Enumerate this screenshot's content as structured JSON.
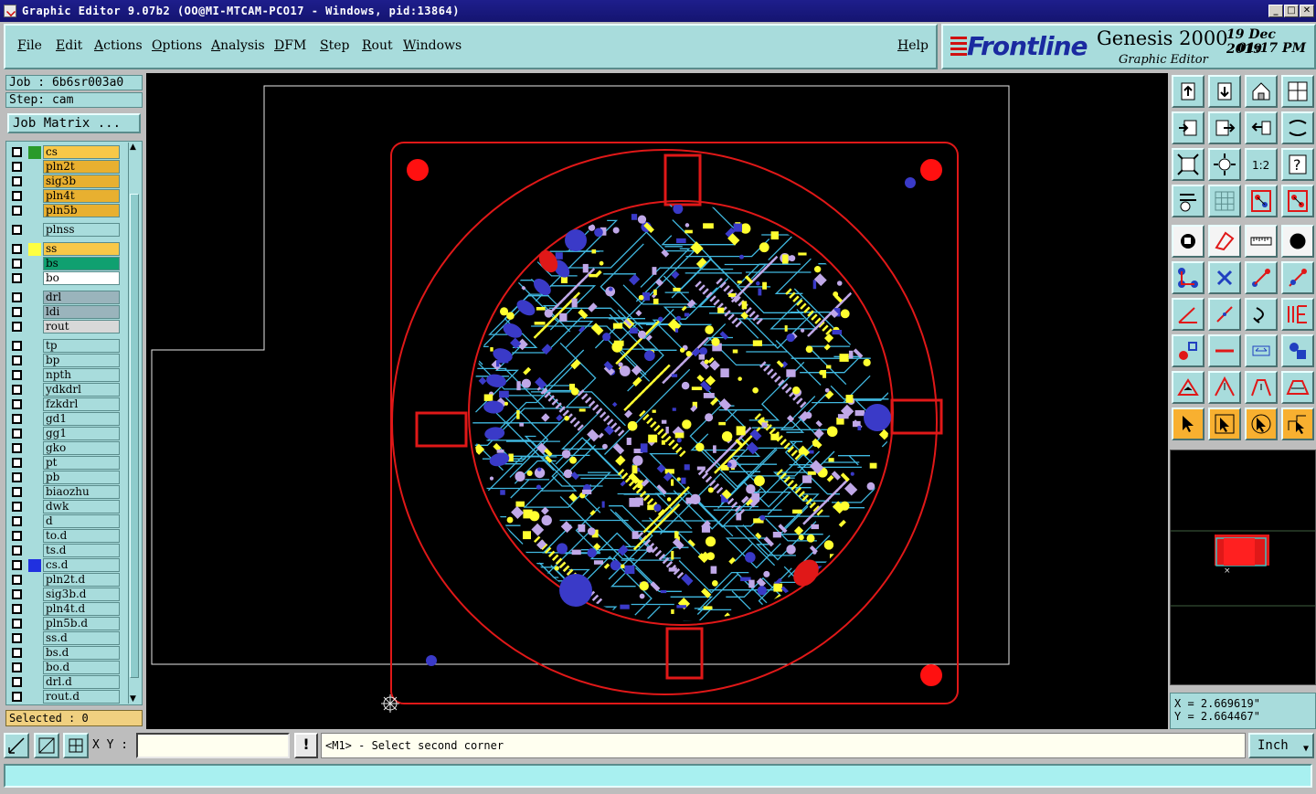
{
  "window": {
    "title": "Graphic Editor 9.07b2 (OO@MI-MTCAM-PCO17 - Windows, pid:13864)",
    "minimize": "_",
    "maximize": "□",
    "close": "✕"
  },
  "menu": {
    "items": [
      "File",
      "Edit",
      "Actions",
      "Options",
      "Analysis",
      "DFM",
      "Step",
      "Rout",
      "Windows"
    ],
    "help": "Help"
  },
  "logo": {
    "brand": "Frontline",
    "product": "Genesis 2000",
    "subtitle": "Graphic Editor",
    "date": "19 Dec 2019",
    "time": "01:17 PM"
  },
  "job": {
    "job_label": "Job : 6b6sr003a0",
    "step_label": "Step: cam",
    "job_matrix_button": "Job Matrix ..."
  },
  "layers": [
    {
      "name": "cs",
      "color": "#f8c848",
      "swatch": "#2a9a2a"
    },
    {
      "name": "pln2t",
      "color": "#e8b030",
      "swatch": ""
    },
    {
      "name": "sig3b",
      "color": "#e8b030",
      "swatch": ""
    },
    {
      "name": "pln4t",
      "color": "#e8b030",
      "swatch": ""
    },
    {
      "name": "pln5b",
      "color": "#e8b030",
      "swatch": ""
    },
    {
      "name": "plnss",
      "color": "#a8dcdc",
      "swatch": ""
    },
    {
      "name": "ss",
      "color": "#f8c848",
      "swatch": "#ffff40"
    },
    {
      "name": "bs",
      "color": "#10a070",
      "swatch": ""
    },
    {
      "name": "bo",
      "color": "#ffffff",
      "swatch": ""
    },
    {
      "name": "drl",
      "color": "#9ab4bc",
      "swatch": ""
    },
    {
      "name": "ldi",
      "color": "#9ab4bc",
      "swatch": ""
    },
    {
      "name": "rout",
      "color": "#d8d8d8",
      "swatch": ""
    },
    {
      "name": "tp",
      "color": "#a8dcdc",
      "swatch": ""
    },
    {
      "name": "bp",
      "color": "#a8dcdc",
      "swatch": ""
    },
    {
      "name": "npth",
      "color": "#a8dcdc",
      "swatch": ""
    },
    {
      "name": "ydkdrl",
      "color": "#a8dcdc",
      "swatch": ""
    },
    {
      "name": "fzkdrl",
      "color": "#a8dcdc",
      "swatch": ""
    },
    {
      "name": "gd1",
      "color": "#a8dcdc",
      "swatch": ""
    },
    {
      "name": "gg1",
      "color": "#a8dcdc",
      "swatch": ""
    },
    {
      "name": "gko",
      "color": "#a8dcdc",
      "swatch": ""
    },
    {
      "name": "pt",
      "color": "#a8dcdc",
      "swatch": ""
    },
    {
      "name": "pb",
      "color": "#a8dcdc",
      "swatch": ""
    },
    {
      "name": "biaozhu",
      "color": "#a8dcdc",
      "swatch": ""
    },
    {
      "name": "dwk",
      "color": "#a8dcdc",
      "swatch": ""
    },
    {
      "name": "d",
      "color": "#a8dcdc",
      "swatch": ""
    },
    {
      "name": "to.d",
      "color": "#a8dcdc",
      "swatch": ""
    },
    {
      "name": "ts.d",
      "color": "#a8dcdc",
      "swatch": ""
    },
    {
      "name": "cs.d",
      "color": "#a8dcdc",
      "swatch": "#2030e0"
    },
    {
      "name": "pln2t.d",
      "color": "#a8dcdc",
      "swatch": ""
    },
    {
      "name": "sig3b.d",
      "color": "#a8dcdc",
      "swatch": ""
    },
    {
      "name": "pln4t.d",
      "color": "#a8dcdc",
      "swatch": ""
    },
    {
      "name": "pln5b.d",
      "color": "#a8dcdc",
      "swatch": ""
    },
    {
      "name": "ss.d",
      "color": "#a8dcdc",
      "swatch": ""
    },
    {
      "name": "bs.d",
      "color": "#a8dcdc",
      "swatch": ""
    },
    {
      "name": "bo.d",
      "color": "#a8dcdc",
      "swatch": ""
    },
    {
      "name": "drl.d",
      "color": "#a8dcdc",
      "swatch": ""
    },
    {
      "name": "rout.d",
      "color": "#a8dcdc",
      "swatch": ""
    }
  ],
  "selected_label": "Selected : 0",
  "tools": [
    {
      "name": "open-job-icon",
      "style": ""
    },
    {
      "name": "save-job-icon",
      "style": ""
    },
    {
      "name": "home-icon",
      "style": ""
    },
    {
      "name": "window-icon",
      "style": ""
    },
    {
      "name": "import-icon",
      "style": ""
    },
    {
      "name": "export-icon",
      "style": ""
    },
    {
      "name": "undo-icon",
      "style": ""
    },
    {
      "name": "redo-icon",
      "style": ""
    },
    {
      "name": "zoom-fit-icon",
      "style": ""
    },
    {
      "name": "zoom-center-icon",
      "style": ""
    },
    {
      "name": "ratio-icon",
      "style": ""
    },
    {
      "name": "help-icon",
      "style": ""
    },
    {
      "name": "settings-icon",
      "style": ""
    },
    {
      "name": "grid-icon",
      "style": ""
    },
    {
      "name": "layer-display-icon",
      "style": ""
    },
    {
      "name": "layer-features-icon",
      "style": ""
    },
    {
      "name": "pad-icon",
      "style": "white"
    },
    {
      "name": "surface-icon",
      "style": "white"
    },
    {
      "name": "ruler-icon",
      "style": "white"
    },
    {
      "name": "round-pad-icon",
      "style": "white"
    },
    {
      "name": "connect-icon",
      "style": ""
    },
    {
      "name": "cross-icon",
      "style": ""
    },
    {
      "name": "line-node-icon",
      "style": ""
    },
    {
      "name": "line-edit-icon",
      "style": ""
    },
    {
      "name": "angle-icon",
      "style": ""
    },
    {
      "name": "slash-icon",
      "style": ""
    },
    {
      "name": "arc-icon",
      "style": ""
    },
    {
      "name": "split-icon",
      "style": ""
    },
    {
      "name": "move-pad-icon",
      "style": ""
    },
    {
      "name": "dash-icon",
      "style": ""
    },
    {
      "name": "measure-icon",
      "style": ""
    },
    {
      "name": "shapes-icon",
      "style": ""
    },
    {
      "name": "triangle-icon",
      "style": ""
    },
    {
      "name": "triangle-up-icon",
      "style": ""
    },
    {
      "name": "trapezoid-icon",
      "style": ""
    },
    {
      "name": "trapezoid-wide-icon",
      "style": ""
    },
    {
      "name": "select-arrow-icon",
      "style": "orange"
    },
    {
      "name": "select-box-icon",
      "style": "orange"
    },
    {
      "name": "select-point-icon",
      "style": "orange"
    },
    {
      "name": "select-path-icon",
      "style": "orange"
    }
  ],
  "coords": {
    "x": "X = 2.669619\"",
    "y": "Y = 2.664467\""
  },
  "cmd": {
    "xy_label": "X Y :",
    "xy_value": "",
    "exclaim": "!",
    "prompt": "<M1> - Select second corner",
    "units": "Inch",
    "units_arrow": "▼"
  },
  "colors": {
    "panel": "#a8dcdc",
    "canvas": "#000000",
    "outline": "#e01818",
    "pad_yellow": "#ffff30",
    "pad_blue": "#3a3ac8",
    "pad_lilac": "#c0a8e8",
    "trace_cyan": "#40b8e0"
  }
}
